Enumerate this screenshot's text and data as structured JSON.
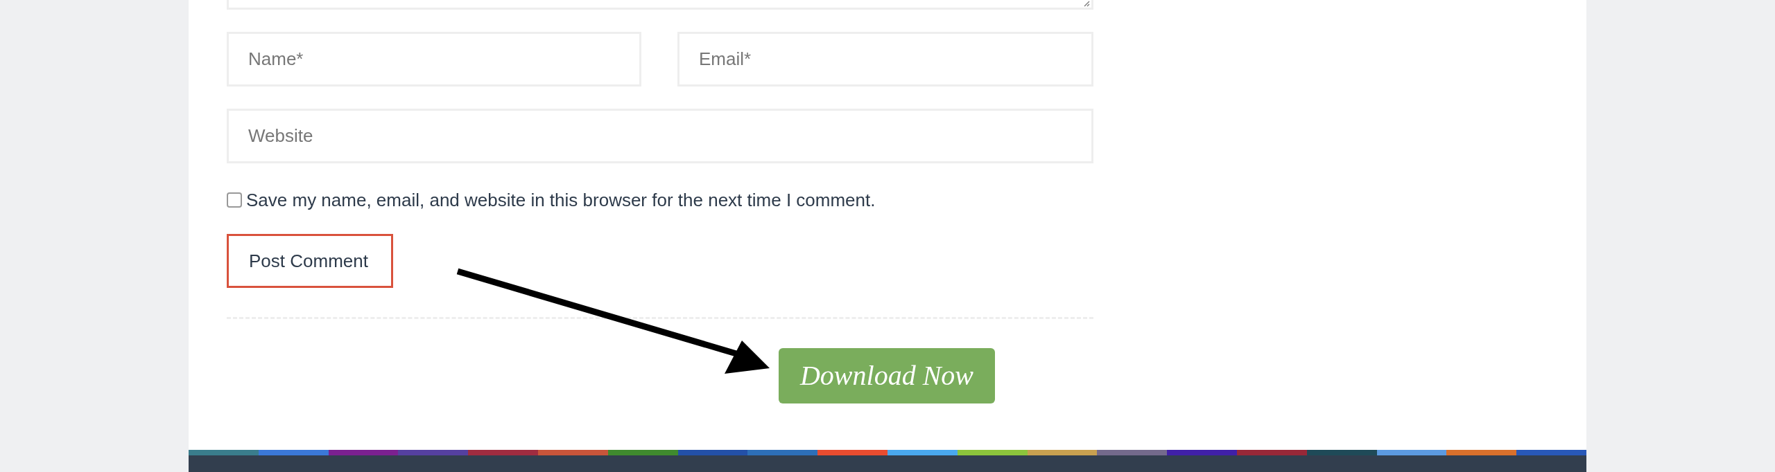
{
  "fields": [
    {
      "placeholder": "Name*"
    },
    {
      "placeholder": "Email*"
    },
    {
      "placeholder": "Website"
    }
  ],
  "consent": {
    "label": "Save my name, email, and website in this browser for the next time I comment.",
    "checked": false
  },
  "submit_button": "Post Comment",
  "download_button": "Download Now"
}
